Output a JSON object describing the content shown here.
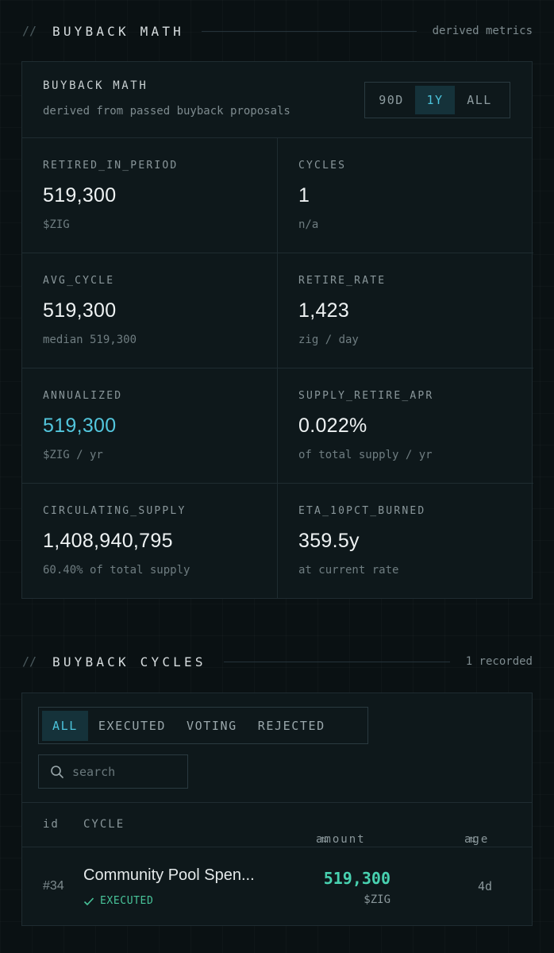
{
  "math_section": {
    "slashes": "//",
    "title": "BUYBACK MATH",
    "meta": "derived metrics"
  },
  "math_panel": {
    "title": "BUYBACK MATH",
    "subtitle": "derived from passed buyback proposals",
    "ranges": [
      "90D",
      "1Y",
      "ALL"
    ],
    "active_range": "1Y",
    "metrics": [
      {
        "key": "RETIRED_IN_PERIOD",
        "value": "519,300",
        "sub": "$ZIG"
      },
      {
        "key": "CYCLES",
        "value": "1",
        "sub": "n/a"
      },
      {
        "key": "AVG_CYCLE",
        "value": "519,300",
        "sub": "median 519,300"
      },
      {
        "key": "RETIRE_RATE",
        "value": "1,423",
        "sub": "zig / day"
      },
      {
        "key": "ANNUALIZED",
        "value": "519,300",
        "sub": "$ZIG / yr"
      },
      {
        "key": "SUPPLY_RETIRE_APR",
        "value": "0.022%",
        "sub": "of total supply / yr"
      },
      {
        "key": "CIRCULATING_SUPPLY",
        "value": "1,408,940,795",
        "sub": "60.40% of total supply"
      },
      {
        "key": "ETA_10PCT_BURNED",
        "value": "359.5y",
        "sub": "at current rate"
      }
    ],
    "accent_color": "#53c6dd"
  },
  "cycles_section": {
    "slashes": "//",
    "title": "BUYBACK CYCLES",
    "meta": "1 recorded"
  },
  "cycles_panel": {
    "tabs": [
      "ALL",
      "EXECUTED",
      "VOTING",
      "REJECTED"
    ],
    "active_tab": "ALL",
    "search_placeholder": "search",
    "columns": {
      "id": "id",
      "cycle": "CYCLE",
      "amount": "amount",
      "age": "age",
      "sort_glyph": "⇅"
    },
    "rows": [
      {
        "id": "#34",
        "name": "Community Pool Spen...",
        "status": "EXECUTED",
        "amount": "519,300",
        "unit": "$ZIG",
        "age": "4d"
      }
    ]
  }
}
